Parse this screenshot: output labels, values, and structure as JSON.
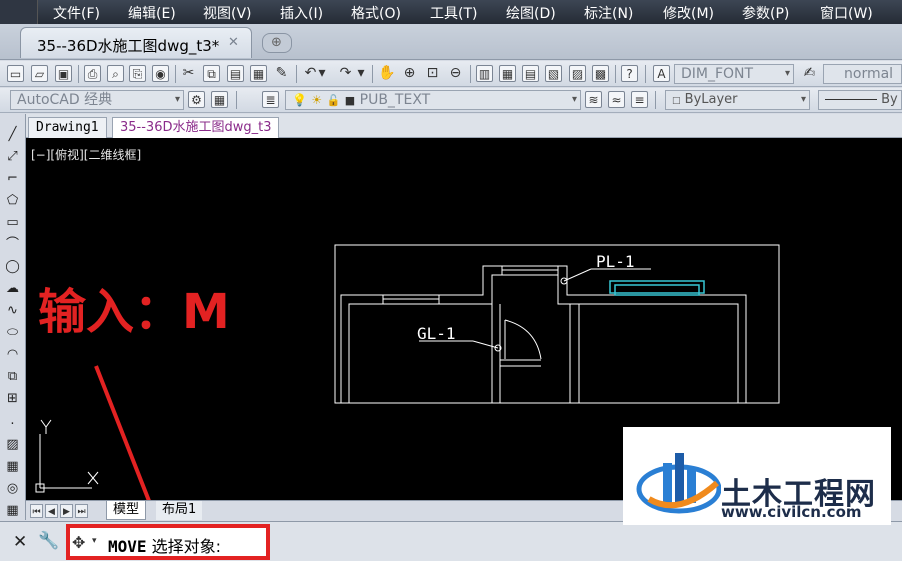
{
  "menu": [
    "文件(F)",
    "编辑(E)",
    "视图(V)",
    "插入(I)",
    "格式(O)",
    "工具(T)",
    "绘图(D)",
    "标注(N)",
    "修改(M)",
    "参数(P)",
    "窗口(W)"
  ],
  "file_tab": {
    "title": "35--36D水施工图dwg_t3*",
    "close": "✕"
  },
  "toolbar1": {
    "dim_style": "DIM_FONT",
    "text_style": "normal"
  },
  "toolbar2": {
    "workspace": "AutoCAD 经典",
    "layer": "PUB_TEXT",
    "color": "ByLayer",
    "linetype": "By"
  },
  "drawing_tabs": [
    "Drawing1",
    "35--36D水施工图dwg_t3"
  ],
  "viewport_label": "[−][俯视][二维线框]",
  "annotation": "输入：M",
  "drawing_labels": {
    "pl": "PL-1",
    "gl": "GL-1"
  },
  "ucs": {
    "x": "X",
    "y": "Y"
  },
  "layout_tabs": [
    "模型",
    "布局1"
  ],
  "command": {
    "keyword": "MOVE",
    "prompt": "选择对象:"
  },
  "watermark": {
    "name": "土木工程网",
    "url": "www.civilcn.com"
  },
  "colors": {
    "annotation": "#e32222",
    "canvas": "#000000",
    "drawing_lines": "#ffffff",
    "window_cyan": "#38c7d6"
  }
}
